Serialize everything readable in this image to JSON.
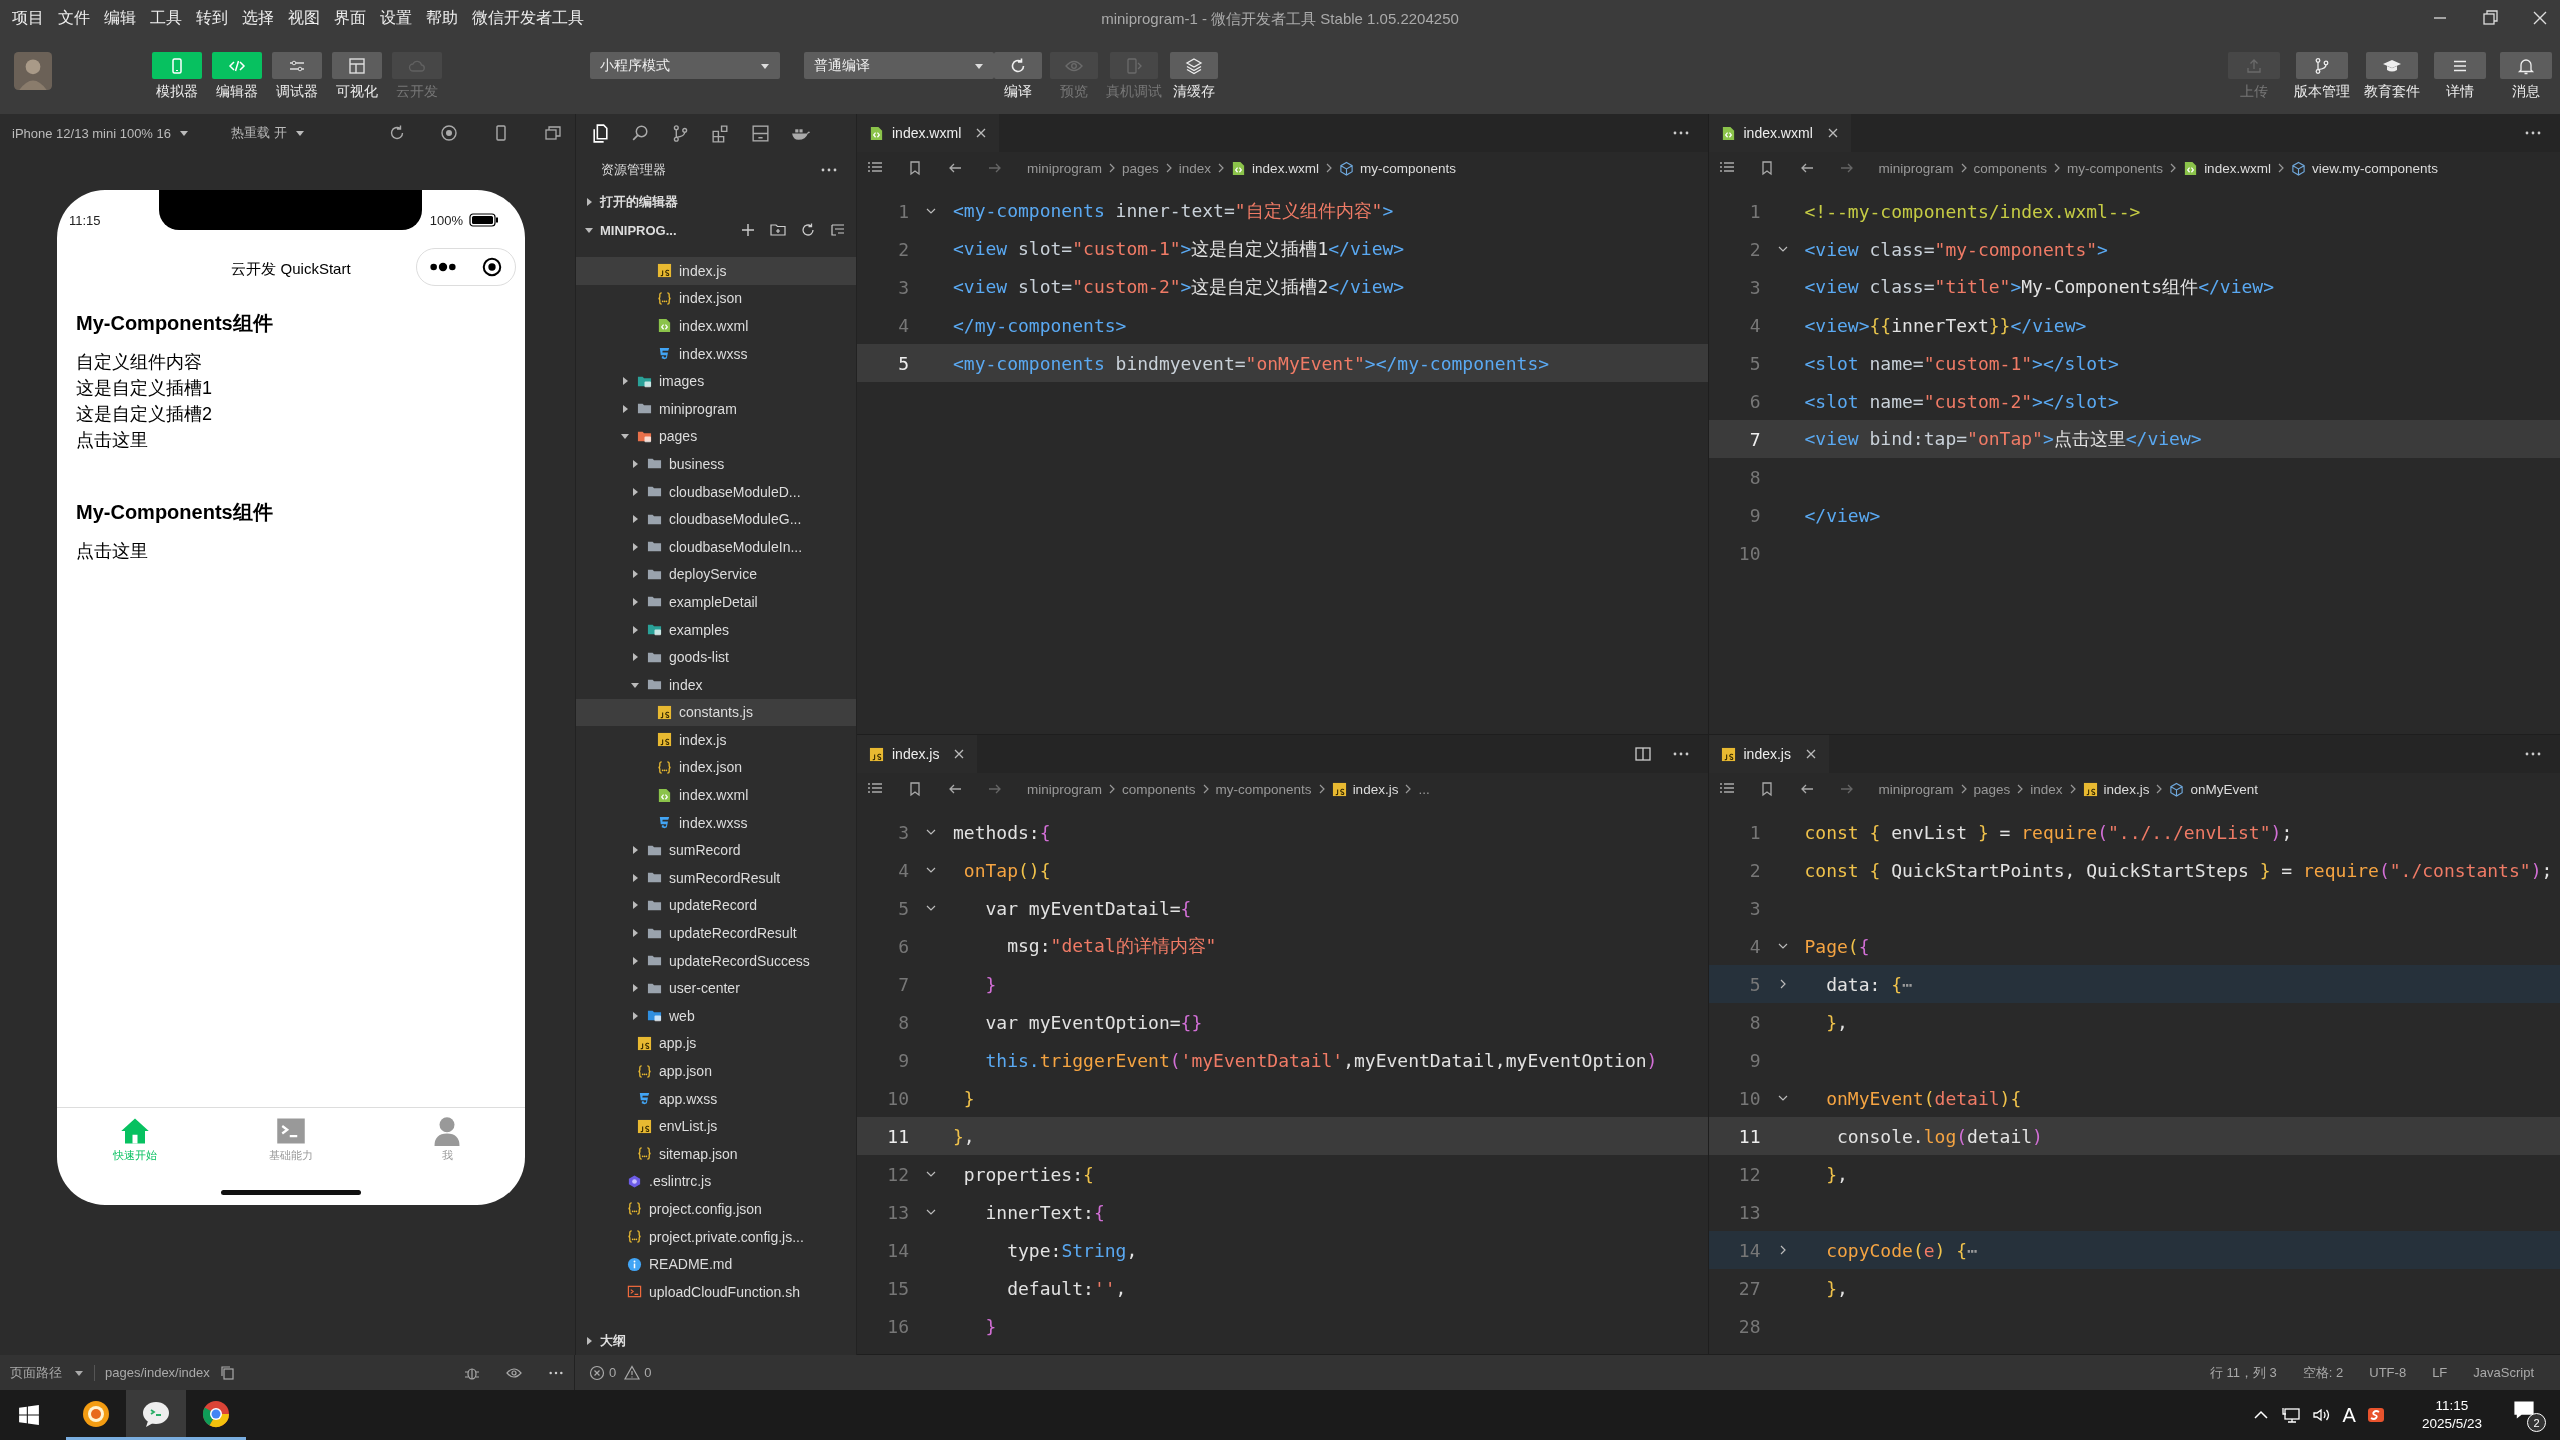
{
  "window": {
    "title": "miniprogram-1 - 微信开发者工具 Stable 1.05.2204250"
  },
  "menu": [
    "项目",
    "文件",
    "编辑",
    "工具",
    "转到",
    "选择",
    "视图",
    "界面",
    "设置",
    "帮助",
    "微信开发者工具"
  ],
  "toolbar": {
    "view_buttons": [
      {
        "label": "模拟器",
        "kind": "phone",
        "on": true,
        "disabled": false
      },
      {
        "label": "编辑器",
        "kind": "code",
        "on": true,
        "disabled": false
      },
      {
        "label": "调试器",
        "kind": "sliders",
        "on": false,
        "disabled": false
      },
      {
        "label": "可视化",
        "kind": "layout",
        "on": false,
        "disabled": false
      },
      {
        "label": "云开发",
        "kind": "cloud",
        "on": false,
        "disabled": true
      }
    ],
    "mode_select": "小程序模式",
    "compile_select": "普通编译",
    "compile_actions": [
      {
        "label": "编译",
        "kind": "refresh",
        "disabled": false
      },
      {
        "label": "预览",
        "kind": "eye",
        "disabled": true
      },
      {
        "label": "真机调试",
        "kind": "device",
        "disabled": true
      },
      {
        "label": "清缓存",
        "kind": "layers",
        "disabled": false
      }
    ],
    "right_buttons": [
      {
        "label": "上传",
        "kind": "upload",
        "disabled": true
      },
      {
        "label": "版本管理",
        "kind": "branch",
        "disabled": false
      },
      {
        "label": "教育套件",
        "kind": "cap",
        "disabled": false
      },
      {
        "label": "详情",
        "kind": "menu",
        "disabled": false
      },
      {
        "label": "消息",
        "kind": "bell",
        "disabled": false
      }
    ]
  },
  "simulator": {
    "device": "iPhone 12/13 mini 100% 16",
    "hot_reload": "热重载 开",
    "phone": {
      "time": "11:15",
      "battery": "100%",
      "nav_title": "云开发 QuickStart",
      "blocks": [
        {
          "title": "My-Components组件",
          "lines": [
            "自定义组件内容",
            "这是自定义插槽1",
            "这是自定义插槽2",
            "点击这里"
          ]
        },
        {
          "title": "My-Components组件",
          "lines": [
            "点击这里"
          ]
        }
      ],
      "tabs": [
        {
          "label": "快速开始",
          "kind": "home",
          "selected": true
        },
        {
          "label": "基础能力",
          "kind": "terminal",
          "selected": false
        },
        {
          "label": "我",
          "kind": "person",
          "selected": false
        }
      ]
    }
  },
  "explorer": {
    "title": "资源管理器",
    "open_editors": {
      "label": "打开的编辑器",
      "expanded": false
    },
    "project": {
      "label": "MINIPROG...",
      "expanded": true
    },
    "component_files": [
      {
        "name": "index.js",
        "kind": "js",
        "selected": true
      },
      {
        "name": "index.json",
        "kind": "json",
        "selected": false
      },
      {
        "name": "index.wxml",
        "kind": "wxml",
        "selected": false
      },
      {
        "name": "index.wxss",
        "kind": "wxss",
        "selected": false
      }
    ],
    "miniprogram_items": [
      {
        "name": "images",
        "kind": "folder-images",
        "expanded": false,
        "selected": false
      },
      {
        "name": "miniprogram",
        "kind": "folder",
        "expanded": false,
        "selected": false
      },
      {
        "name": "pages",
        "kind": "folder-pages",
        "expanded": true,
        "selected": false,
        "children": [
          {
            "name": "business",
            "kind": "folder",
            "expanded": false,
            "selected": false
          },
          {
            "name": "cloudbaseModuleD...",
            "kind": "folder",
            "expanded": false,
            "selected": false
          },
          {
            "name": "cloudbaseModuleG...",
            "kind": "folder",
            "expanded": false,
            "selected": false
          },
          {
            "name": "cloudbaseModuleIn...",
            "kind": "folder",
            "expanded": false,
            "selected": false
          },
          {
            "name": "deployService",
            "kind": "folder",
            "expanded": false,
            "selected": false
          },
          {
            "name": "exampleDetail",
            "kind": "folder",
            "expanded": false,
            "selected": false
          },
          {
            "name": "examples",
            "kind": "folder-images",
            "expanded": false,
            "selected": false
          },
          {
            "name": "goods-list",
            "kind": "folder",
            "expanded": false,
            "selected": false
          },
          {
            "name": "index",
            "kind": "folder",
            "expanded": true,
            "selected": false,
            "children": [
              {
                "name": "constants.js",
                "kind": "js",
                "selected": true
              },
              {
                "name": "index.js",
                "kind": "js",
                "selected": false
              },
              {
                "name": "index.json",
                "kind": "json",
                "selected": false
              },
              {
                "name": "index.wxml",
                "kind": "wxml",
                "selected": false
              },
              {
                "name": "index.wxss",
                "kind": "wxss",
                "selected": false
              }
            ]
          },
          {
            "name": "sumRecord",
            "kind": "folder",
            "expanded": false,
            "selected": false
          },
          {
            "name": "sumRecordResult",
            "kind": "folder",
            "expanded": false,
            "selected": false
          },
          {
            "name": "updateRecord",
            "kind": "folder",
            "expanded": false,
            "selected": false
          },
          {
            "name": "updateRecordResult",
            "kind": "folder",
            "expanded": false,
            "selected": false
          },
          {
            "name": "updateRecordSuccess",
            "kind": "folder",
            "expanded": false,
            "selected": false
          },
          {
            "name": "user-center",
            "kind": "folder",
            "expanded": false,
            "selected": false
          },
          {
            "name": "web",
            "kind": "folder-web",
            "expanded": false,
            "selected": false
          }
        ]
      },
      {
        "name": "app.js",
        "kind": "js",
        "selected": false
      },
      {
        "name": "app.json",
        "kind": "json",
        "selected": false
      },
      {
        "name": "app.wxss",
        "kind": "wxss",
        "selected": false
      },
      {
        "name": "envList.js",
        "kind": "js",
        "selected": false
      },
      {
        "name": "sitemap.json",
        "kind": "json",
        "selected": false
      }
    ],
    "root_items": [
      {
        "name": ".eslintrc.js",
        "kind": "eslint",
        "selected": false
      },
      {
        "name": "project.config.json",
        "kind": "json",
        "selected": false
      },
      {
        "name": "project.private.config.js...",
        "kind": "json",
        "selected": false
      },
      {
        "name": "README.md",
        "kind": "info",
        "selected": false
      },
      {
        "name": "uploadCloudFunction.sh",
        "kind": "shell",
        "selected": false
      }
    ],
    "outline": {
      "label": "大纲",
      "expanded": false
    }
  },
  "editors": [
    {
      "tab": {
        "label": "index.wxml",
        "kind": "wxml"
      },
      "actions": [
        {
          "kind": "more"
        }
      ],
      "breadcrumb": [
        {
          "text": "miniprogram",
          "kind": "folder"
        },
        {
          "text": "pages",
          "kind": "folder"
        },
        {
          "text": "index",
          "kind": "folder"
        },
        {
          "text": "index.wxml",
          "kind": "wxml"
        },
        {
          "text": "my-components",
          "kind": "symbol"
        }
      ],
      "lines": [
        {
          "n": "1",
          "kind": "fold_start",
          "current": false,
          "tokens": [
            {
              "kind": "tag",
              "text": "<my-components"
            },
            {
              "kind": "attr",
              "text": " inner-text="
            },
            {
              "kind": "str",
              "text": "\"自定义组件内容\""
            },
            {
              "kind": "tag",
              "text": ">"
            }
          ]
        },
        {
          "n": "2",
          "kind": "line",
          "current": false,
          "tokens": [
            {
              "kind": "tag",
              "text": "<view"
            },
            {
              "kind": "attr",
              "text": " slot="
            },
            {
              "kind": "str",
              "text": "\"custom-1\""
            },
            {
              "kind": "tag",
              "text": ">"
            },
            {
              "kind": "plain",
              "text": "这是自定义插槽1"
            },
            {
              "kind": "tag",
              "text": "</view>"
            }
          ]
        },
        {
          "n": "3",
          "kind": "line",
          "current": false,
          "tokens": [
            {
              "kind": "tag",
              "text": "<view"
            },
            {
              "kind": "attr",
              "text": " slot="
            },
            {
              "kind": "str",
              "text": "\"custom-2\""
            },
            {
              "kind": "tag",
              "text": ">"
            },
            {
              "kind": "plain",
              "text": "这是自定义插槽2"
            },
            {
              "kind": "tag",
              "text": "</view>"
            }
          ]
        },
        {
          "n": "4",
          "kind": "line",
          "current": false,
          "tokens": [
            {
              "kind": "tag",
              "text": "</my-components>"
            }
          ]
        },
        {
          "n": "5",
          "kind": "line",
          "current": true,
          "tokens": [
            {
              "kind": "tag",
              "text": "<my-components"
            },
            {
              "kind": "attr",
              "text": " bindmyevent="
            },
            {
              "kind": "str",
              "text": "\"onMyEvent\""
            },
            {
              "kind": "tag",
              "text": "></my-components>"
            }
          ]
        }
      ]
    },
    {
      "tab": {
        "label": "index.wxml",
        "kind": "wxml"
      },
      "actions": [
        {
          "kind": "more"
        }
      ],
      "breadcrumb": [
        {
          "text": "miniprogram",
          "kind": "folder"
        },
        {
          "text": "components",
          "kind": "folder"
        },
        {
          "text": "my-components",
          "kind": "folder"
        },
        {
          "text": "index.wxml",
          "kind": "wxml"
        },
        {
          "text": "view.my-components",
          "kind": "symbol"
        }
      ],
      "lines": [
        {
          "n": "1",
          "kind": "line",
          "current": false,
          "tokens": [
            {
              "kind": "comment",
              "text": "<!--my-components/index.wxml-->"
            }
          ]
        },
        {
          "n": "2",
          "kind": "fold_start",
          "current": false,
          "tokens": [
            {
              "kind": "tag",
              "text": "<view"
            },
            {
              "kind": "attr",
              "text": " class="
            },
            {
              "kind": "str",
              "text": "\"my-components\""
            },
            {
              "kind": "tag",
              "text": ">"
            }
          ]
        },
        {
          "n": "3",
          "kind": "line",
          "current": false,
          "tokens": [
            {
              "kind": "tag",
              "text": "<view"
            },
            {
              "kind": "attr",
              "text": " class="
            },
            {
              "kind": "str",
              "text": "\"title\""
            },
            {
              "kind": "tag",
              "text": ">"
            },
            {
              "kind": "plain",
              "text": "My-Components组件"
            },
            {
              "kind": "tag",
              "text": "</view>"
            }
          ]
        },
        {
          "n": "4",
          "kind": "line",
          "current": false,
          "tokens": [
            {
              "kind": "tag",
              "text": "<view>"
            },
            {
              "kind": "tmpl",
              "text": "{{"
            },
            {
              "kind": "plain",
              "text": "innerText"
            },
            {
              "kind": "tmpl",
              "text": "}}"
            },
            {
              "kind": "tag",
              "text": "</view>"
            }
          ]
        },
        {
          "n": "5",
          "kind": "line",
          "current": false,
          "tokens": [
            {
              "kind": "tag",
              "text": "<slot"
            },
            {
              "kind": "attr",
              "text": " name="
            },
            {
              "kind": "str",
              "text": "\"custom-1\""
            },
            {
              "kind": "tag",
              "text": "></slot>"
            }
          ]
        },
        {
          "n": "6",
          "kind": "line",
          "current": false,
          "tokens": [
            {
              "kind": "tag",
              "text": "<slot"
            },
            {
              "kind": "attr",
              "text": " name="
            },
            {
              "kind": "str",
              "text": "\"custom-2\""
            },
            {
              "kind": "tag",
              "text": "></slot>"
            }
          ]
        },
        {
          "n": "7",
          "kind": "line",
          "current": true,
          "tokens": [
            {
              "kind": "tag",
              "text": "<view"
            },
            {
              "kind": "attr",
              "text": " bind:tap="
            },
            {
              "kind": "str",
              "text": "\"onTap\""
            },
            {
              "kind": "tag",
              "text": ">"
            },
            {
              "kind": "plain",
              "text": "点击这里"
            },
            {
              "kind": "tag",
              "text": "</view>"
            }
          ]
        },
        {
          "n": "8",
          "kind": "line",
          "current": false
        },
        {
          "n": "9",
          "kind": "line",
          "current": false,
          "tokens": [
            {
              "kind": "tag",
              "text": "</view>"
            }
          ]
        },
        {
          "n": "10",
          "kind": "line",
          "current": false
        }
      ]
    },
    {
      "tab": {
        "label": "index.js",
        "kind": "js"
      },
      "actions": [
        {
          "kind": "split"
        },
        {
          "kind": "more"
        }
      ],
      "breadcrumb": [
        {
          "text": "miniprogram",
          "kind": "folder"
        },
        {
          "text": "components",
          "kind": "folder"
        },
        {
          "text": "my-components",
          "kind": "folder"
        },
        {
          "text": "index.js",
          "kind": "js"
        },
        {
          "text": "...",
          "kind": "folder"
        }
      ],
      "lines": [
        {
          "n": "3",
          "kind": "fold_start",
          "current": false,
          "tokens": [
            {
              "kind": "plain",
              "text": "methods:"
            },
            {
              "kind": "brace",
              "text": "{"
            }
          ]
        },
        {
          "n": "4",
          "kind": "fold_start",
          "current": false,
          "tokens": [
            {
              "kind": "fn",
              "text": " onTap"
            },
            {
              "kind": "paren",
              "text": "(){"
            }
          ]
        },
        {
          "n": "5",
          "kind": "fold_start",
          "current": false,
          "tokens": [
            {
              "kind": "plain",
              "text": "   var myEventDatail="
            },
            {
              "kind": "brace",
              "text": "{"
            }
          ]
        },
        {
          "n": "6",
          "kind": "line",
          "current": false,
          "tokens": [
            {
              "kind": "plain",
              "text": "     msg:"
            },
            {
              "kind": "str",
              "text": "\"detal的详情内容\""
            }
          ]
        },
        {
          "n": "7",
          "kind": "line",
          "current": false,
          "tokens": [
            {
              "kind": "brace",
              "text": "   }"
            }
          ]
        },
        {
          "n": "8",
          "kind": "line",
          "current": false,
          "tokens": [
            {
              "kind": "plain",
              "text": "   var myEventOption="
            },
            {
              "kind": "brace",
              "text": "{}"
            }
          ]
        },
        {
          "n": "9",
          "kind": "line",
          "current": false,
          "tokens": [
            {
              "kind": "this",
              "text": "   this."
            },
            {
              "kind": "fn",
              "text": "triggerEvent"
            },
            {
              "kind": "brace",
              "text": "("
            },
            {
              "kind": "str",
              "text": "'myEventDatail'"
            },
            {
              "kind": "plain",
              "text": ",myEventDatail,myEventOption"
            },
            {
              "kind": "brace",
              "text": ")"
            }
          ]
        },
        {
          "n": "10",
          "kind": "line",
          "current": false,
          "tokens": [
            {
              "kind": "paren",
              "text": " }"
            }
          ]
        },
        {
          "n": "11",
          "kind": "line",
          "current": true,
          "tokens": [
            {
              "kind": "paren",
              "text": "}"
            },
            {
              "kind": "plain",
              "text": ","
            }
          ]
        },
        {
          "n": "12",
          "kind": "fold_start",
          "current": false,
          "tokens": [
            {
              "kind": "plain",
              "text": " properties:"
            },
            {
              "kind": "paren",
              "text": "{"
            }
          ]
        },
        {
          "n": "13",
          "kind": "fold_start",
          "current": false,
          "tokens": [
            {
              "kind": "plain",
              "text": "   innerText:"
            },
            {
              "kind": "brace",
              "text": "{"
            }
          ]
        },
        {
          "n": "14",
          "kind": "line",
          "current": false,
          "tokens": [
            {
              "kind": "plain",
              "text": "     type:"
            },
            {
              "kind": "this",
              "text": "String"
            },
            {
              "kind": "plain",
              "text": ","
            }
          ]
        },
        {
          "n": "15",
          "kind": "line",
          "current": false,
          "tokens": [
            {
              "kind": "plain",
              "text": "     default:"
            },
            {
              "kind": "str",
              "text": "''"
            },
            {
              "kind": "plain",
              "text": ","
            }
          ]
        },
        {
          "n": "16",
          "kind": "line",
          "current": false,
          "tokens": [
            {
              "kind": "brace",
              "text": "   }"
            }
          ]
        }
      ]
    },
    {
      "tab": {
        "label": "index.js",
        "kind": "js"
      },
      "actions": [
        {
          "kind": "more"
        }
      ],
      "breadcrumb": [
        {
          "text": "miniprogram",
          "kind": "folder"
        },
        {
          "text": "pages",
          "kind": "folder"
        },
        {
          "text": "index",
          "kind": "folder"
        },
        {
          "text": "index.js",
          "kind": "js"
        },
        {
          "text": "onMyEvent",
          "kind": "symbol"
        }
      ],
      "lines": [
        {
          "n": "1",
          "kind": "line",
          "current": false,
          "tokens": [
            {
              "kind": "kw",
              "text": "const"
            },
            {
              "kind": "paren",
              "text": " {"
            },
            {
              "kind": "plain",
              "text": " envList "
            },
            {
              "kind": "paren",
              "text": "}"
            },
            {
              "kind": "plain",
              "text": " = "
            },
            {
              "kind": "fn",
              "text": "require"
            },
            {
              "kind": "brace",
              "text": "("
            },
            {
              "kind": "str",
              "text": "\"../../envList\""
            },
            {
              "kind": "brace",
              "text": ")"
            },
            {
              "kind": "plain",
              "text": ";"
            }
          ]
        },
        {
          "n": "2",
          "kind": "line",
          "current": false,
          "tokens": [
            {
              "kind": "kw",
              "text": "const"
            },
            {
              "kind": "paren",
              "text": " {"
            },
            {
              "kind": "plain",
              "text": " QuickStartPoints, QuickStartSteps "
            },
            {
              "kind": "paren",
              "text": "}"
            },
            {
              "kind": "plain",
              "text": " = "
            },
            {
              "kind": "fn",
              "text": "require"
            },
            {
              "kind": "brace",
              "text": "("
            },
            {
              "kind": "str",
              "text": "\"./constants\""
            },
            {
              "kind": "brace",
              "text": ")"
            },
            {
              "kind": "plain",
              "text": ";"
            }
          ]
        },
        {
          "n": "3",
          "kind": "line",
          "current": false
        },
        {
          "n": "4",
          "kind": "fold_start",
          "current": false,
          "tokens": [
            {
              "kind": "fn",
              "text": "Page"
            },
            {
              "kind": "paren",
              "text": "("
            },
            {
              "kind": "brace",
              "text": "{"
            }
          ]
        },
        {
          "n": "5",
          "kind": "folded",
          "current": false,
          "tokens": [
            {
              "kind": "plain",
              "text": "  data: "
            },
            {
              "kind": "paren",
              "text": "{"
            },
            {
              "kind": "dim",
              "text": "⋯"
            }
          ]
        },
        {
          "n": "8",
          "kind": "line",
          "current": false,
          "tokens": [
            {
              "kind": "paren",
              "text": "  }"
            },
            {
              "kind": "plain",
              "text": ","
            }
          ]
        },
        {
          "n": "9",
          "kind": "line",
          "current": false
        },
        {
          "n": "10",
          "kind": "fold_start",
          "current": false,
          "tokens": [
            {
              "kind": "fn",
              "text": "  onMyEvent"
            },
            {
              "kind": "paren",
              "text": "("
            },
            {
              "kind": "param",
              "text": "detail"
            },
            {
              "kind": "paren",
              "text": "){"
            }
          ]
        },
        {
          "n": "11",
          "kind": "line",
          "current": true,
          "tokens": [
            {
              "kind": "plain",
              "text": "   console."
            },
            {
              "kind": "fn",
              "text": "log"
            },
            {
              "kind": "brace",
              "text": "("
            },
            {
              "kind": "plain",
              "text": "detail"
            },
            {
              "kind": "brace",
              "text": ")"
            }
          ]
        },
        {
          "n": "12",
          "kind": "line",
          "current": false,
          "tokens": [
            {
              "kind": "paren",
              "text": "  }"
            },
            {
              "kind": "plain",
              "text": ","
            }
          ]
        },
        {
          "n": "13",
          "kind": "line",
          "current": false
        },
        {
          "n": "14",
          "kind": "folded",
          "current": false,
          "tokens": [
            {
              "kind": "fn",
              "text": "  copyCode"
            },
            {
              "kind": "paren",
              "text": "("
            },
            {
              "kind": "param",
              "text": "e"
            },
            {
              "kind": "paren",
              "text": ") {"
            },
            {
              "kind": "dim",
              "text": "⋯"
            }
          ]
        },
        {
          "n": "27",
          "kind": "line",
          "current": false,
          "tokens": [
            {
              "kind": "paren",
              "text": "  }"
            },
            {
              "kind": "plain",
              "text": ","
            }
          ]
        },
        {
          "n": "28",
          "kind": "line",
          "current": false
        }
      ]
    }
  ],
  "status": {
    "page_path_label": "页面路径",
    "page_path": "pages/index/index",
    "errors": "0",
    "warnings": "0",
    "items": [
      "行 11，列 3",
      "空格: 2",
      "UTF-8",
      "LF",
      "JavaScript"
    ]
  },
  "taskbar": {
    "apps": [
      {
        "kind": "ring",
        "selected": false
      },
      {
        "kind": "chat",
        "selected": true
      },
      {
        "kind": "chrome",
        "selected": false
      }
    ],
    "ime": "A",
    "time": "11:15",
    "date": "2025/5/23",
    "notifications": "2"
  }
}
